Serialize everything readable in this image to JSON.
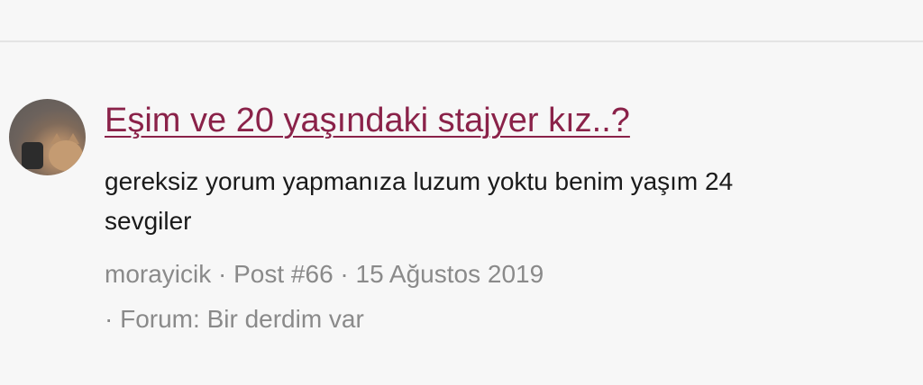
{
  "result": {
    "title": "Eşim ve 20 yaşındaki stajyer kız..?",
    "snippet_line1": "gereksiz yorum yapmanıza luzum yoktu benim yaşım 24",
    "snippet_line2": "sevgiler",
    "author": "morayicik",
    "separator": " · ",
    "post": "Post #66",
    "date": "15 Ağustos 2019",
    "forum_prefix": "· Forum: ",
    "forum_name": "Bir derdim var"
  }
}
